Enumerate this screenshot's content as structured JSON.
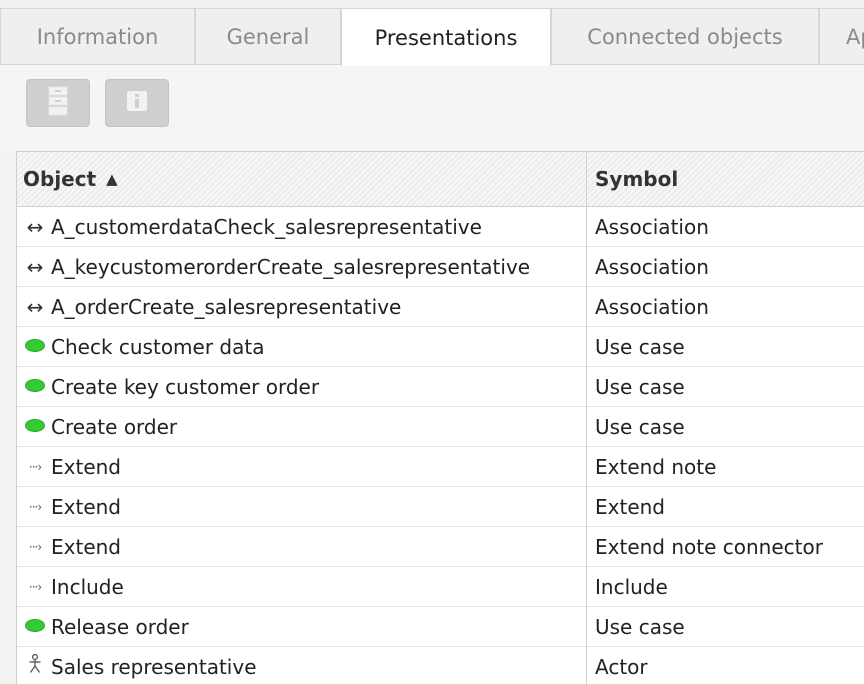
{
  "tabs": [
    {
      "label": "Information",
      "active": false
    },
    {
      "label": "General",
      "active": false
    },
    {
      "label": "Presentations",
      "active": true
    },
    {
      "label": "Connected objects",
      "active": false
    },
    {
      "label": "Ap",
      "active": false
    }
  ],
  "toolbar": {
    "buttons": [
      {
        "icon": "properties-icon"
      },
      {
        "icon": "info-icon"
      }
    ]
  },
  "table": {
    "columns": [
      {
        "label": "Object",
        "sort": "ascending",
        "sort_icon": "▲"
      },
      {
        "label": "Symbol"
      }
    ],
    "rows": [
      {
        "icon": "association-icon",
        "glyph": "↔",
        "object": "A_customerdataCheck_salesrepresentative",
        "symbol": "Association"
      },
      {
        "icon": "association-icon",
        "glyph": "↔",
        "object": "A_keycustomerorderCreate_salesrepresentative",
        "symbol": "Association"
      },
      {
        "icon": "association-icon",
        "glyph": "↔",
        "object": "A_orderCreate_salesrepresentative",
        "symbol": "Association"
      },
      {
        "icon": "use-case-icon",
        "glyph": "",
        "object": "Check customer data",
        "symbol": "Use case"
      },
      {
        "icon": "use-case-icon",
        "glyph": "",
        "object": "Create key customer order",
        "symbol": "Use case"
      },
      {
        "icon": "use-case-icon",
        "glyph": "",
        "object": "Create order",
        "symbol": "Use case"
      },
      {
        "icon": "dependency-arrow-icon",
        "glyph": "···›",
        "object": "Extend",
        "symbol": "Extend note"
      },
      {
        "icon": "dependency-arrow-icon",
        "glyph": "···›",
        "object": "Extend",
        "symbol": "Extend"
      },
      {
        "icon": "dependency-arrow-icon",
        "glyph": "···›",
        "object": "Extend",
        "symbol": "Extend note connector"
      },
      {
        "icon": "dependency-arrow-icon",
        "glyph": "···›",
        "object": "Include",
        "symbol": "Include"
      },
      {
        "icon": "use-case-icon",
        "glyph": "",
        "object": "Release order",
        "symbol": "Use case"
      },
      {
        "icon": "actor-icon",
        "glyph": "",
        "object": "Sales representative",
        "symbol": "Actor"
      }
    ]
  },
  "colors": {
    "use_case_green": "#33cc33",
    "button_gray": "#cfcfcf",
    "active_tab_bg": "#ffffff"
  }
}
